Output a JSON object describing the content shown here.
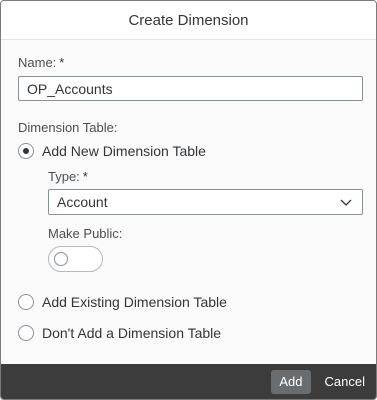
{
  "dialog": {
    "title": "Create Dimension"
  },
  "name_field": {
    "label": "Name:",
    "required_mark": "*",
    "value": "OP_Accounts"
  },
  "dimension_table": {
    "label": "Dimension Table:",
    "options": [
      {
        "label": "Add New Dimension Table",
        "selected": true
      },
      {
        "label": "Add Existing Dimension Table",
        "selected": false
      },
      {
        "label": "Don't Add a Dimension Table",
        "selected": false
      }
    ]
  },
  "type_field": {
    "label": "Type:",
    "required_mark": "*",
    "value": "Account"
  },
  "make_public": {
    "label": "Make Public:",
    "on": false
  },
  "footer": {
    "add_label": "Add",
    "cancel_label": "Cancel"
  },
  "colors": {
    "footer_bg": "#3c3c3c",
    "add_button_bg": "#6a6d70",
    "text": "#32363a"
  }
}
